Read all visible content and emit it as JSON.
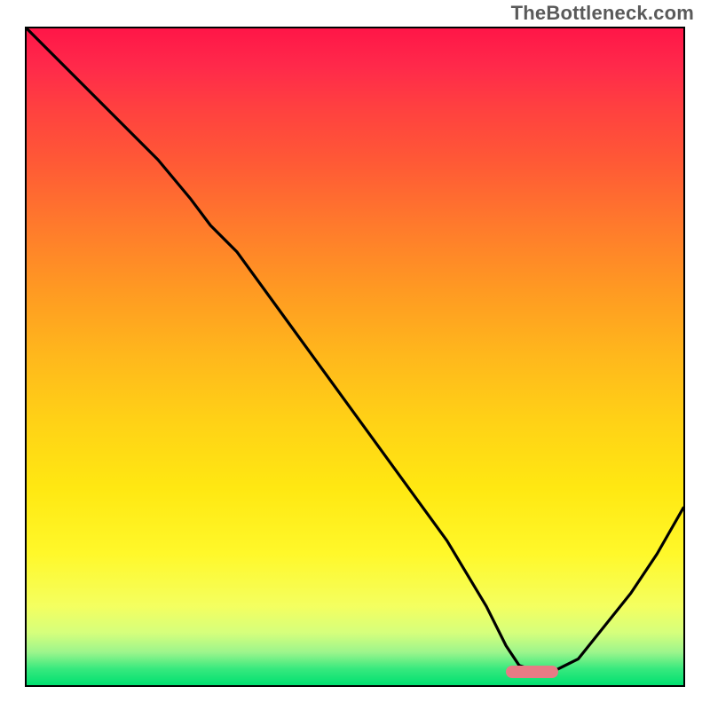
{
  "watermark": "TheBottleneck.com",
  "colors": {
    "curve_stroke": "#000000",
    "marker": "#e87b85",
    "border": "#000000"
  },
  "chart_data": {
    "type": "line",
    "title": "",
    "xlabel": "",
    "ylabel": "",
    "xlim": [
      0,
      100
    ],
    "ylim": [
      0,
      100
    ],
    "grid": false,
    "legend": false,
    "notes": "Axes unlabeled. x is horizontal position (0=left edge of plot, 100=right). y is vertical height (0=bottom, 100=top). Background gradient encodes value by vertical position (green=good near bottom, red=bad near top) but no numeric colorbar is shown.",
    "series": [
      {
        "name": "bottleneck-curve",
        "x": [
          0,
          5,
          10,
          15,
          20,
          25,
          28,
          32,
          40,
          48,
          56,
          64,
          70,
          73,
          75,
          78,
          80,
          84,
          88,
          92,
          96,
          100
        ],
        "y": [
          100,
          95,
          90,
          85,
          80,
          74,
          70,
          66,
          55,
          44,
          33,
          22,
          12,
          6,
          3,
          2,
          2,
          4,
          9,
          14,
          20,
          27
        ]
      }
    ],
    "marker": {
      "name": "optimal-range",
      "x_center": 77,
      "y": 2,
      "x_width": 8
    },
    "gradient_stops": [
      {
        "pos": 0.0,
        "color": "#ff1648"
      },
      {
        "pos": 0.5,
        "color": "#ffd216"
      },
      {
        "pos": 0.88,
        "color": "#f4ff60"
      },
      {
        "pos": 1.0,
        "color": "#00e070"
      }
    ]
  }
}
